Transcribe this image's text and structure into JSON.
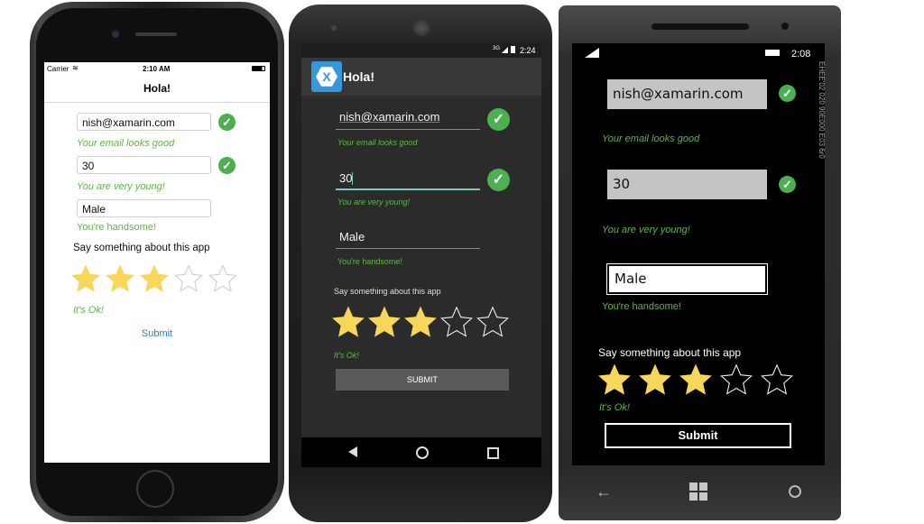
{
  "ios": {
    "carrier": "Carrier",
    "time": "2:10 AM",
    "title": "Hola!",
    "email_value": "nish@xamarin.com",
    "email_msg": "Your email looks good",
    "age_value": "30",
    "age_msg": "You are very young!",
    "gender_value": "Male",
    "gender_msg": "You're handsome!",
    "prompt": "Say something about this app",
    "rating": 3,
    "rating_max": 5,
    "rating_msg": "It's Ok!",
    "submit": "Submit"
  },
  "android": {
    "status_time": "2:24",
    "status_network": "3G",
    "title": "Hola!",
    "logo_letter": "X",
    "email_value": "nish@xamarin.com",
    "email_msg": "Your email looks good",
    "age_value": "30",
    "age_msg": "You are very young!",
    "gender_value": "Male",
    "gender_msg": "You're handsome!",
    "prompt": "Say something about this app",
    "rating": 3,
    "rating_max": 5,
    "rating_msg": "It's Ok!",
    "submit": "SUBMIT"
  },
  "winphone": {
    "time": "2:08",
    "email_value": "nish@xamarin.com",
    "email_msg": "Your email looks good",
    "age_value": "30",
    "age_msg": "You are very young!",
    "gender_value": "Male",
    "gender_msg": "You're handsome!",
    "prompt": "Say something about this app",
    "rating": 3,
    "rating_max": 5,
    "rating_msg": "It's Ok!",
    "submit": "Submit",
    "side_text": "EHEE'02 020 90E000 E03 6r0"
  },
  "colors": {
    "star_fill": "#f7d659",
    "valid_green": "#5cb844",
    "ios_link": "#1a7cf0",
    "android_bar": "#383838"
  }
}
